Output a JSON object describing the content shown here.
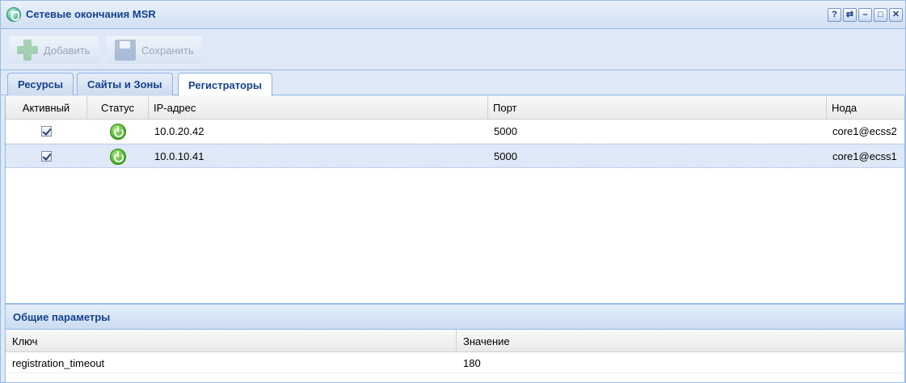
{
  "window": {
    "title": "Сетевые окончания MSR",
    "tools": [
      "?",
      "⇄",
      "–",
      "□",
      "✕"
    ]
  },
  "toolbar": {
    "add_label": "Добавить",
    "save_label": "Сохранить"
  },
  "tabs": [
    {
      "label": "Ресурсы"
    },
    {
      "label": "Сайты и Зоны"
    },
    {
      "label": "Регистраторы",
      "active": true
    }
  ],
  "registrars": {
    "columns": [
      "Активный",
      "Статус",
      "IP-адрес",
      "Порт",
      "Нода"
    ],
    "rows": [
      {
        "active": true,
        "status": "power-on-icon",
        "ip": "10.0.20.42",
        "port": "5000",
        "node": "core1@ecss2"
      },
      {
        "active": true,
        "status": "power-on-icon",
        "ip": "10.0.10.41",
        "port": "5000",
        "node": "core1@ecss1",
        "selected": true
      }
    ]
  },
  "params": {
    "title": "Общие параметры",
    "columns": [
      "Ключ",
      "Значение"
    ],
    "rows": [
      {
        "key": "registration_timeout",
        "value": "180"
      }
    ]
  },
  "colors": {
    "header_text": "#15428b",
    "frame_border": "#99bbe8",
    "selected_row": "#dfe8f6",
    "status_on": "#3faa1e"
  }
}
